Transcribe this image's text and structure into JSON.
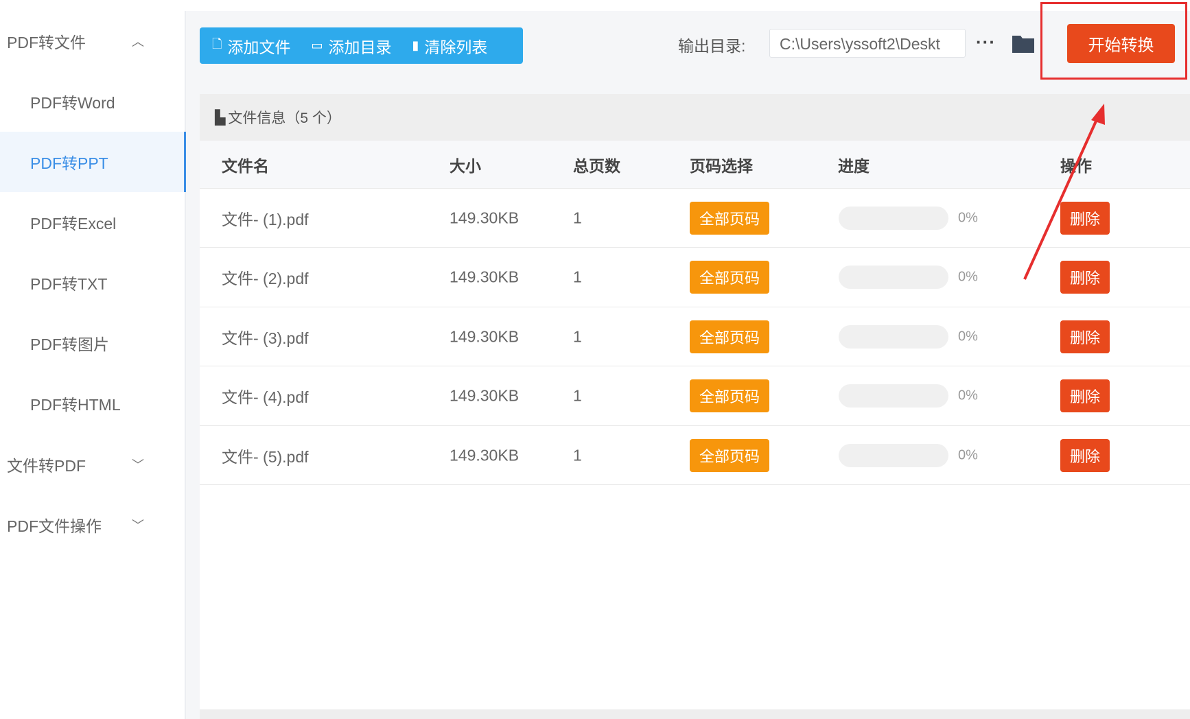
{
  "sidebar": {
    "groups": [
      {
        "label": "PDF转文件",
        "expanded": true,
        "items": [
          "PDF转Word",
          "PDF转PPT",
          "PDF转Excel",
          "PDF转TXT",
          "PDF转图片",
          "PDF转HTML"
        ]
      },
      {
        "label": "文件转PDF"
      },
      {
        "label": "PDF文件操作"
      }
    ],
    "active": "PDF转PPT"
  },
  "toolbar": {
    "add_file": "添加文件",
    "add_dir": "添加目录",
    "clear_list": "清除列表"
  },
  "output": {
    "label": "输出目录:",
    "path": "C:\\Users\\yssoft2\\Deskt",
    "more": "···",
    "start": "开始转换"
  },
  "table": {
    "info": "文件信息（5 个）",
    "headers": [
      "文件名",
      "大小",
      "总页数",
      "页码选择",
      "进度",
      "操作"
    ],
    "rows": [
      {
        "name": "文件- (1).pdf",
        "size": "149.30KB",
        "pages": "1",
        "select": "全部页码",
        "progress": "0%",
        "action": "删除"
      },
      {
        "name": "文件- (2).pdf",
        "size": "149.30KB",
        "pages": "1",
        "select": "全部页码",
        "progress": "0%",
        "action": "删除"
      },
      {
        "name": "文件- (3).pdf",
        "size": "149.30KB",
        "pages": "1",
        "select": "全部页码",
        "progress": "0%",
        "action": "删除"
      },
      {
        "name": "文件- (4).pdf",
        "size": "149.30KB",
        "pages": "1",
        "select": "全部页码",
        "progress": "0%",
        "action": "删除"
      },
      {
        "name": "文件- (5).pdf",
        "size": "149.30KB",
        "pages": "1",
        "select": "全部页码",
        "progress": "0%",
        "action": "删除"
      }
    ]
  },
  "colors": {
    "primary": "#2eaaec",
    "start": "#e8491c",
    "badge": "#f7960c",
    "annotation": "#e62e2e"
  }
}
